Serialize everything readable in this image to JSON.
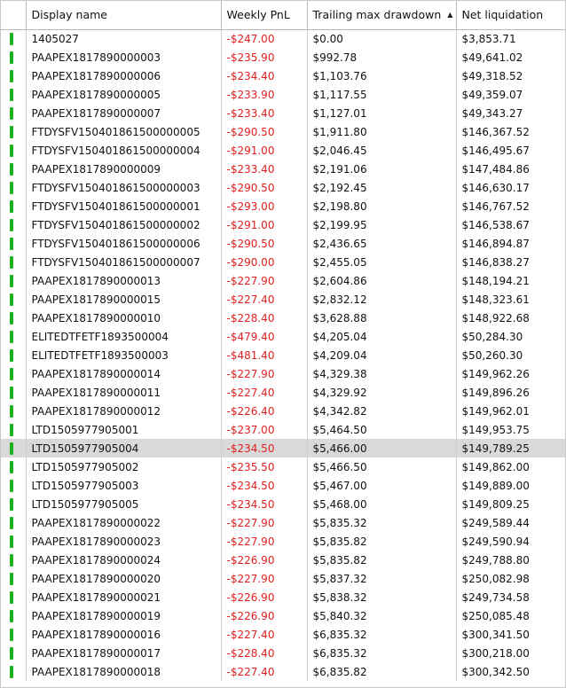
{
  "columns": {
    "status": "",
    "display_name": "Display name",
    "weekly_pnl": "Weekly PnL",
    "trailing_max_drawdown": "Trailing max drawdown",
    "net_liquidation": "Net liquidation"
  },
  "sort": {
    "column": "trailing_max_drawdown",
    "direction": "ascending",
    "arrow": "▲"
  },
  "colors": {
    "status_active": "#1db11d",
    "negative": "#e02020",
    "selected_row": "#d9d9d9"
  },
  "selected_row_index": 22,
  "rows": [
    {
      "name": "1405027",
      "pnl": "-$247.00",
      "drawdown": "$0.00",
      "liquidation": "$3,853.71"
    },
    {
      "name": "PAAPEX1817890000003",
      "pnl": "-$235.90",
      "drawdown": "$992.78",
      "liquidation": "$49,641.02"
    },
    {
      "name": "PAAPEX1817890000006",
      "pnl": "-$234.40",
      "drawdown": "$1,103.76",
      "liquidation": "$49,318.52"
    },
    {
      "name": "PAAPEX1817890000005",
      "pnl": "-$233.90",
      "drawdown": "$1,117.55",
      "liquidation": "$49,359.07"
    },
    {
      "name": "PAAPEX1817890000007",
      "pnl": "-$233.40",
      "drawdown": "$1,127.01",
      "liquidation": "$49,343.27"
    },
    {
      "name": "FTDYSFV150401861500000005",
      "pnl": "-$290.50",
      "drawdown": "$1,911.80",
      "liquidation": "$146,367.52"
    },
    {
      "name": "FTDYSFV150401861500000004",
      "pnl": "-$291.00",
      "drawdown": "$2,046.45",
      "liquidation": "$146,495.67"
    },
    {
      "name": "PAAPEX1817890000009",
      "pnl": "-$233.40",
      "drawdown": "$2,191.06",
      "liquidation": "$147,484.86"
    },
    {
      "name": "FTDYSFV150401861500000003",
      "pnl": "-$290.50",
      "drawdown": "$2,192.45",
      "liquidation": "$146,630.17"
    },
    {
      "name": "FTDYSFV150401861500000001",
      "pnl": "-$293.00",
      "drawdown": "$2,198.80",
      "liquidation": "$146,767.52"
    },
    {
      "name": "FTDYSFV150401861500000002",
      "pnl": "-$291.00",
      "drawdown": "$2,199.95",
      "liquidation": "$146,538.67"
    },
    {
      "name": "FTDYSFV150401861500000006",
      "pnl": "-$290.50",
      "drawdown": "$2,436.65",
      "liquidation": "$146,894.87"
    },
    {
      "name": "FTDYSFV150401861500000007",
      "pnl": "-$290.00",
      "drawdown": "$2,455.05",
      "liquidation": "$146,838.27"
    },
    {
      "name": "PAAPEX1817890000013",
      "pnl": "-$227.90",
      "drawdown": "$2,604.86",
      "liquidation": "$148,194.21"
    },
    {
      "name": "PAAPEX1817890000015",
      "pnl": "-$227.40",
      "drawdown": "$2,832.12",
      "liquidation": "$148,323.61"
    },
    {
      "name": "PAAPEX1817890000010",
      "pnl": "-$228.40",
      "drawdown": "$3,628.88",
      "liquidation": "$148,922.68"
    },
    {
      "name": "ELITEDTFETF1893500004",
      "pnl": "-$479.40",
      "drawdown": "$4,205.04",
      "liquidation": "$50,284.30"
    },
    {
      "name": "ELITEDTFETF1893500003",
      "pnl": "-$481.40",
      "drawdown": "$4,209.04",
      "liquidation": "$50,260.30"
    },
    {
      "name": "PAAPEX1817890000014",
      "pnl": "-$227.90",
      "drawdown": "$4,329.38",
      "liquidation": "$149,962.26"
    },
    {
      "name": "PAAPEX1817890000011",
      "pnl": "-$227.40",
      "drawdown": "$4,329.92",
      "liquidation": "$149,896.26"
    },
    {
      "name": "PAAPEX1817890000012",
      "pnl": "-$226.40",
      "drawdown": "$4,342.82",
      "liquidation": "$149,962.01"
    },
    {
      "name": "LTD1505977905001",
      "pnl": "-$237.00",
      "drawdown": "$5,464.50",
      "liquidation": "$149,953.75"
    },
    {
      "name": "LTD1505977905004",
      "pnl": "-$234.50",
      "drawdown": "$5,466.00",
      "liquidation": "$149,789.25"
    },
    {
      "name": "LTD1505977905002",
      "pnl": "-$235.50",
      "drawdown": "$5,466.50",
      "liquidation": "$149,862.00"
    },
    {
      "name": "LTD1505977905003",
      "pnl": "-$234.50",
      "drawdown": "$5,467.00",
      "liquidation": "$149,889.00"
    },
    {
      "name": "LTD1505977905005",
      "pnl": "-$234.50",
      "drawdown": "$5,468.00",
      "liquidation": "$149,809.25"
    },
    {
      "name": "PAAPEX1817890000022",
      "pnl": "-$227.90",
      "drawdown": "$5,835.32",
      "liquidation": "$249,589.44"
    },
    {
      "name": "PAAPEX1817890000023",
      "pnl": "-$227.90",
      "drawdown": "$5,835.82",
      "liquidation": "$249,590.94"
    },
    {
      "name": "PAAPEX1817890000024",
      "pnl": "-$226.90",
      "drawdown": "$5,835.82",
      "liquidation": "$249,788.80"
    },
    {
      "name": "PAAPEX1817890000020",
      "pnl": "-$227.90",
      "drawdown": "$5,837.32",
      "liquidation": "$250,082.98"
    },
    {
      "name": "PAAPEX1817890000021",
      "pnl": "-$226.90",
      "drawdown": "$5,838.32",
      "liquidation": "$249,734.58"
    },
    {
      "name": "PAAPEX1817890000019",
      "pnl": "-$226.90",
      "drawdown": "$5,840.32",
      "liquidation": "$250,085.48"
    },
    {
      "name": "PAAPEX1817890000016",
      "pnl": "-$227.40",
      "drawdown": "$6,835.32",
      "liquidation": "$300,341.50"
    },
    {
      "name": "PAAPEX1817890000017",
      "pnl": "-$228.40",
      "drawdown": "$6,835.32",
      "liquidation": "$300,218.00"
    },
    {
      "name": "PAAPEX1817890000018",
      "pnl": "-$227.40",
      "drawdown": "$6,835.82",
      "liquidation": "$300,342.50"
    }
  ]
}
